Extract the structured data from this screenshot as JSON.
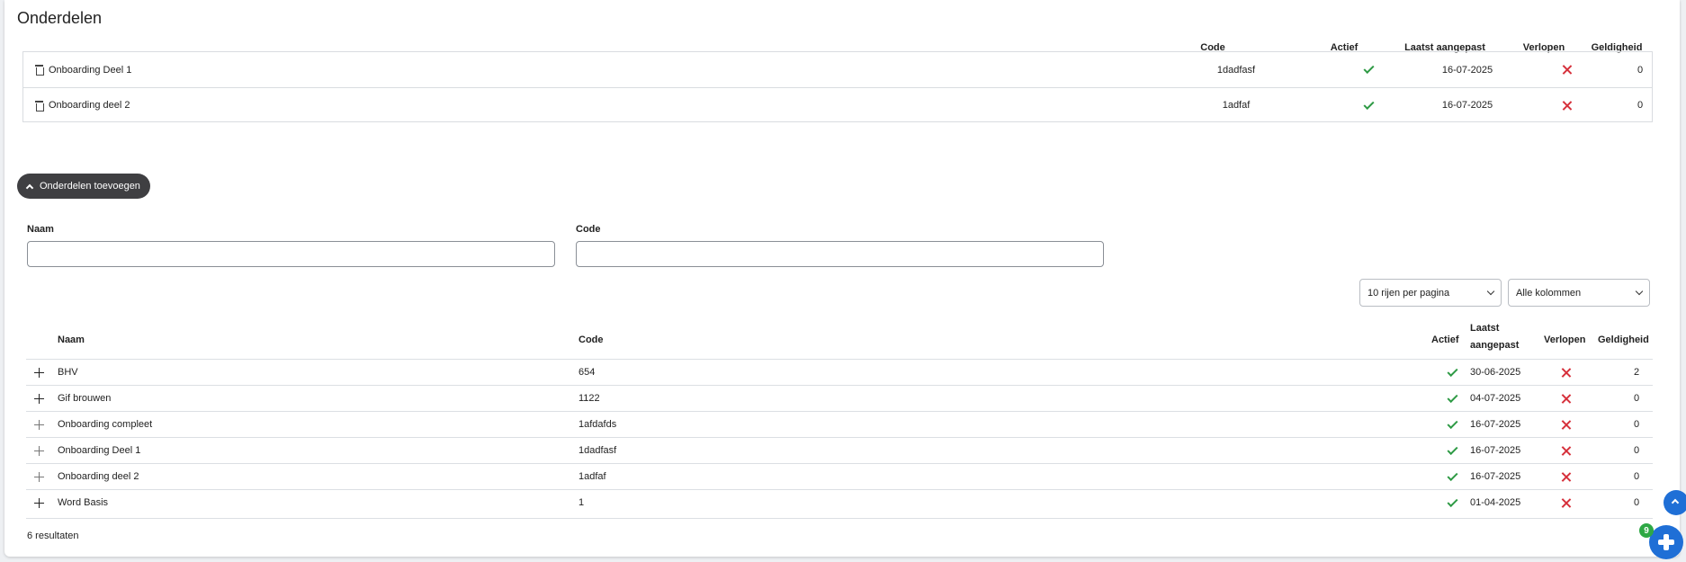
{
  "page_title": "Onderdelen",
  "selected": {
    "headers": {
      "code": "Code",
      "actief": "Actief",
      "laatst": "Laatst aangepast",
      "verlopen": "Verlopen",
      "geldigheid": "Geldigheid"
    },
    "rows": [
      {
        "name": "Onboarding Deel 1",
        "code": "1dadfasf",
        "actief": true,
        "laatst": "16-07-2025",
        "verlopen": false,
        "geldigheid": "0"
      },
      {
        "name": "Onboarding deel 2",
        "code": "1adfaf",
        "actief": true,
        "laatst": "16-07-2025",
        "verlopen": false,
        "geldigheid": "0"
      }
    ]
  },
  "toggle_button": {
    "label": "Onderdelen toevoegen"
  },
  "filters": {
    "naam_label": "Naam",
    "naam_value": "",
    "code_label": "Code",
    "code_value": "",
    "rows_per_page": "10 rijen per pagina",
    "columns": "Alle kolommen"
  },
  "table": {
    "headers": {
      "naam": "Naam",
      "code": "Code",
      "actief": "Actief",
      "laatst_1": "Laatst",
      "laatst_2": "aangepast",
      "verlopen": "Verlopen",
      "geldigheid": "Geldigheid"
    },
    "rows": [
      {
        "name": "BHV",
        "code": "654",
        "actief": true,
        "laatst": "30-06-2025",
        "verlopen": false,
        "geldigheid": "2",
        "added": false
      },
      {
        "name": "Gif brouwen",
        "code": "1122",
        "actief": true,
        "laatst": "04-07-2025",
        "verlopen": false,
        "geldigheid": "0",
        "added": false
      },
      {
        "name": "Onboarding compleet",
        "code": "1afdafds",
        "actief": true,
        "laatst": "16-07-2025",
        "verlopen": false,
        "geldigheid": "0",
        "added": true
      },
      {
        "name": "Onboarding Deel 1",
        "code": "1dadfasf",
        "actief": true,
        "laatst": "16-07-2025",
        "verlopen": false,
        "geldigheid": "0",
        "added": true
      },
      {
        "name": "Onboarding deel 2",
        "code": "1adfaf",
        "actief": true,
        "laatst": "16-07-2025",
        "verlopen": false,
        "geldigheid": "0",
        "added": true
      },
      {
        "name": "Word Basis",
        "code": "1",
        "actief": true,
        "laatst": "01-04-2025",
        "verlopen": false,
        "geldigheid": "0",
        "added": false
      }
    ],
    "results_text": "6 resultaten"
  },
  "fab": {
    "badge_count": "9"
  },
  "colors": {
    "check": "#2e9a45",
    "cross": "#d6303b",
    "primary": "#1f6fd6",
    "button_dark": "#3f3f42"
  }
}
